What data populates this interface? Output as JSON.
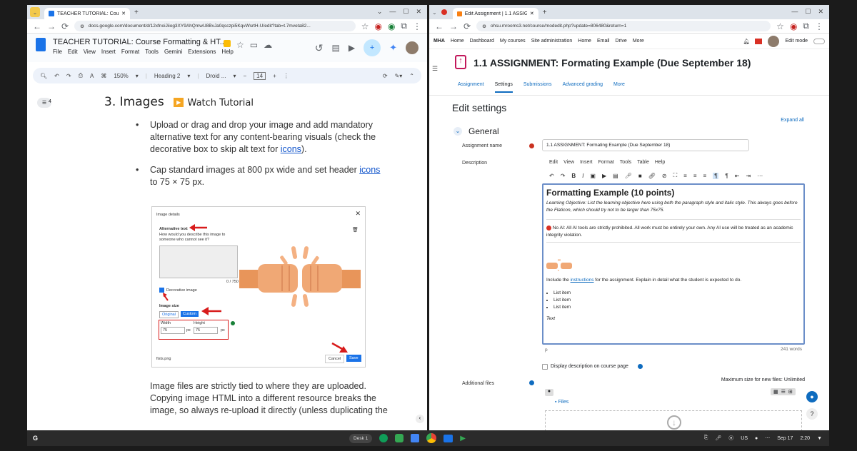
{
  "left": {
    "tab_title": "TEACHER TUTORIAL: Course F",
    "url": "docs.google.com/document/d/12xfnoiJiiog3XY9AhQmwU8BvJa0qsczpi5KqvWsrtH-U/edit?tab=t.7mveta82...",
    "doc_title": "TEACHER TUTORIAL: Course Formatting & HT...",
    "menus": [
      "File",
      "Edit",
      "View",
      "Insert",
      "Format",
      "Tools",
      "Gemini",
      "Extensions",
      "Help"
    ],
    "zoom": "150%",
    "style": "Heading 2",
    "font": "Droid ...",
    "font_size": "14",
    "outline_count": "4",
    "heading": "3.  Images",
    "watch": "Watch Tutorial",
    "bullet1": "Upload or drag and drop your image and add mandatory alternative text for any content-bearing visuals (check the decorative box to skip alt text for ",
    "bullet1_link": "icons",
    "bullet1_end": ").",
    "bullet2a": "Cap standard images at 800 px wide and set header ",
    "bullet2_link": "icons",
    "bullet2b": " to 75 × 75 px.",
    "dlg": {
      "title": "Image details",
      "alt_label": "Alternative text",
      "alt_q": "How would you describe this image to someone who cannot see it?",
      "counter": "0 / 750",
      "decorative": "Decorative image",
      "size_label": "Image size",
      "original": "Original",
      "custom": "Custom",
      "width_l": "Width",
      "height_l": "Height",
      "width_v": "75",
      "height_v": "75",
      "px": "px",
      "filename": "fists.png",
      "cancel": "Cancel",
      "save": "Save"
    },
    "bullet3": "Image files are strictly tied to where they are uploaded. Copying image HTML into a different resource breaks the image, so always re-upload it directly (unless duplicating the"
  },
  "right": {
    "tab_title": "Edit Assignment | 1.1 ASSIGN",
    "url": "ohsu.mrooms3.net/course/modedit.php?update=806480&return=1",
    "nav": [
      "MHA",
      "Home",
      "Dashboard",
      "My courses",
      "Site administration",
      "Home",
      "Email",
      "Drive",
      "More"
    ],
    "edit_mode": "Edit mode",
    "page_title": "1.1 ASSIGNMENT: Formating Example (Due September 18)",
    "subtabs": [
      "Assignment",
      "Settings",
      "Submissions",
      "Advanced grading",
      "More"
    ],
    "edit_settings": "Edit settings",
    "expand_all": "Expand all",
    "general": "General",
    "assignment_name_label": "Assignment name",
    "assignment_name": "1.1 ASSIGNMENT: Formating Example (Due September 18)",
    "description_label": "Description",
    "editor_menu": [
      "Edit",
      "View",
      "Insert",
      "Format",
      "Tools",
      "Table",
      "Help"
    ],
    "content_title": "Formatting Example (10 points)",
    "objective": "Learning Objective: List the learning objective here using both the paragraph style and italic style. This always goes before the Flaticon, which should try not to be larger than 75x75.",
    "noai": "No AI: All AI tools are strictly prohibited. All work must be entirely your own. Any AI use will be treated as an academic integrity violation.",
    "include_a": "Include the ",
    "include_link": "instructions",
    "include_b": " for the assignment. Explain in detail what the student is expected to do.",
    "list": [
      "List item",
      "List item",
      "List item"
    ],
    "text": "Text",
    "status_p": "p",
    "words": "241 words",
    "display_desc": "Display description on course page",
    "additional_files": "Additional files",
    "max_size": "Maximum size for new files: Unlimited",
    "files": "Files"
  },
  "shelf": {
    "desk": "Desk 1",
    "lang": "US",
    "date": "Sep 17",
    "time": "2:20"
  }
}
